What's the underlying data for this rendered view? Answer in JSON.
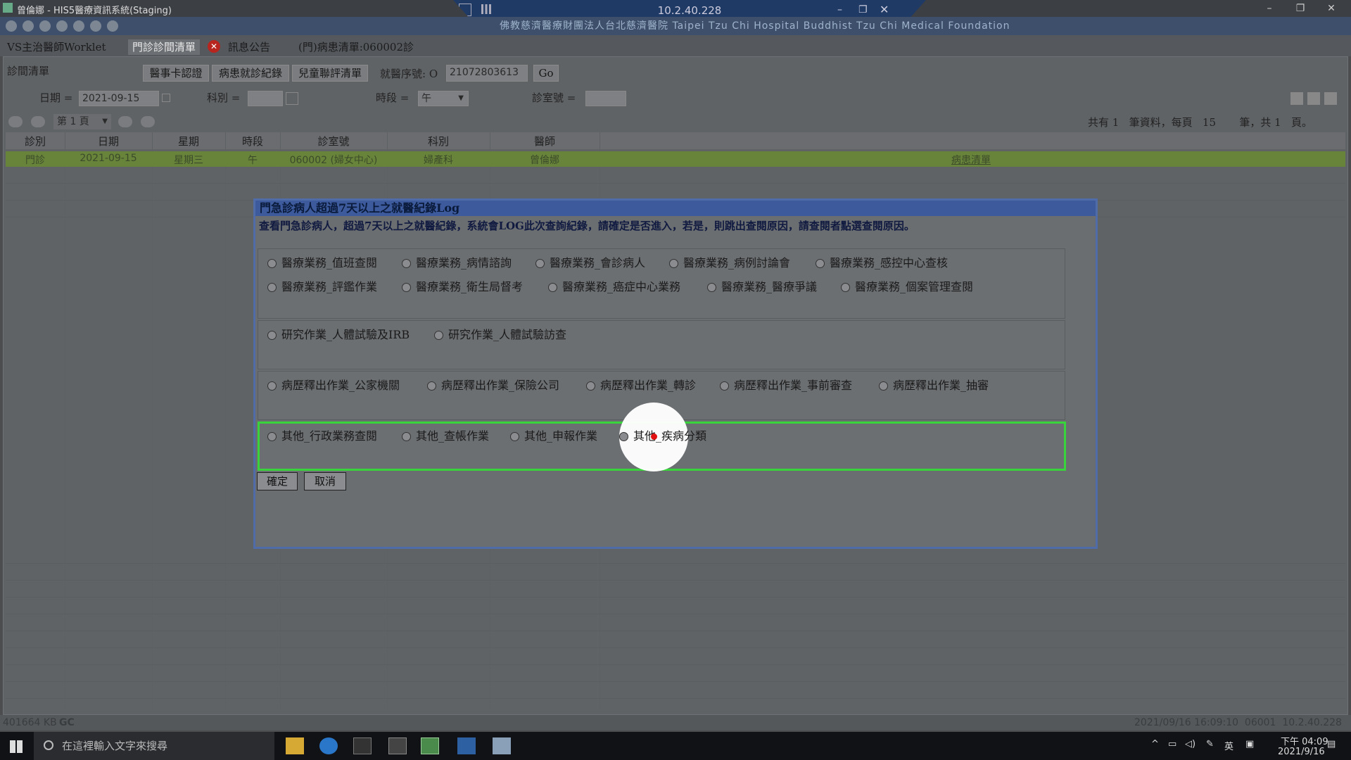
{
  "window": {
    "title": "曾倫娜 - HIS5醫療資訊系統(Staging)",
    "rdp_ip": "10.2.40.228",
    "banner_text": "佛教慈濟醫療財團法人台北慈濟醫院 Taipei Tzu Chi Hospital Buddhist Tzu Chi Medical Foundation",
    "min": "–",
    "max": "❐",
    "close": "✕"
  },
  "tabs": [
    {
      "label": "VS主治醫師Worklet"
    },
    {
      "label": "門診診間清單"
    },
    {
      "label": "訊息公告"
    },
    {
      "label": "(門)病患清單:060002診"
    }
  ],
  "toolbar": {
    "section_title": "診間清單",
    "btn_card": "醫事卡認證",
    "btn_history": "病患就診紀錄",
    "btn_child": "兒童聯評清單",
    "visit_no_label": "就醫序號: O",
    "visit_no_value": "21072803613",
    "go": "Go"
  },
  "filters": {
    "date_label": "日期 =",
    "date_value": "2021-09-15",
    "dept_label": "科別 =",
    "session_label": "時段 =",
    "session_value": "午",
    "room_label": "診室號 ="
  },
  "pager": {
    "page_label": "第 1 頁",
    "summary": "共有 1   筆資料，每頁   15       筆，共 1   頁。"
  },
  "grid": {
    "headers": [
      "診別",
      "日期",
      "星期",
      "時段",
      "診室號",
      "科別",
      "醫師"
    ],
    "row": [
      "門診",
      "2021-09-15",
      "星期三",
      "午",
      "060002 (婦女中心)",
      "婦產科",
      "曾倫娜"
    ],
    "row_link": "病患清單"
  },
  "dialog": {
    "title": "門急診病人超過7天以上之就醫紀錄Log",
    "message": "查看門急診病人，超過7天以上之就醫紀錄，系統會LOG此次查詢紀錄，請確定是否進入，若是，則跳出查閱原因，請查閱者點選查閱原因。",
    "group1": [
      "醫療業務_值班查閱",
      "醫療業務_病情諮詢",
      "醫療業務_會診病人",
      "醫療業務_病例討論會",
      "醫療業務_感控中心查核",
      "醫療業務_評鑑作業",
      "醫療業務_衛生局督考",
      "醫療業務_癌症中心業務",
      "醫療業務_醫療爭議",
      "醫療業務_個案管理查閱"
    ],
    "group2": [
      "研究作業_人體試驗及IRB",
      "研究作業_人體試驗訪查"
    ],
    "group3": [
      "病歷釋出作業_公家機關",
      "病歷釋出作業_保險公司",
      "病歷釋出作業_轉診",
      "病歷釋出作業_事前審查",
      "病歷釋出作業_抽審"
    ],
    "group4": [
      "其他_行政業務查閱",
      "其他_查帳作業",
      "其他_申報作業",
      "其他_疾病分類"
    ],
    "ok": "確定",
    "cancel": "取消"
  },
  "status": {
    "memory": "401664 KB",
    "gc": "GC",
    "right": "2021/09/16 16:09:10  06001  10.2.40.228"
  },
  "taskbar": {
    "search_placeholder": "在這裡輸入文字來搜尋",
    "ime": "英",
    "time": "下午 04:09",
    "date": "2021/9/16"
  },
  "colors": {
    "highlight": "#39d33c",
    "dialog_border": "#4f6ca8",
    "row_selected": "#68843a"
  }
}
